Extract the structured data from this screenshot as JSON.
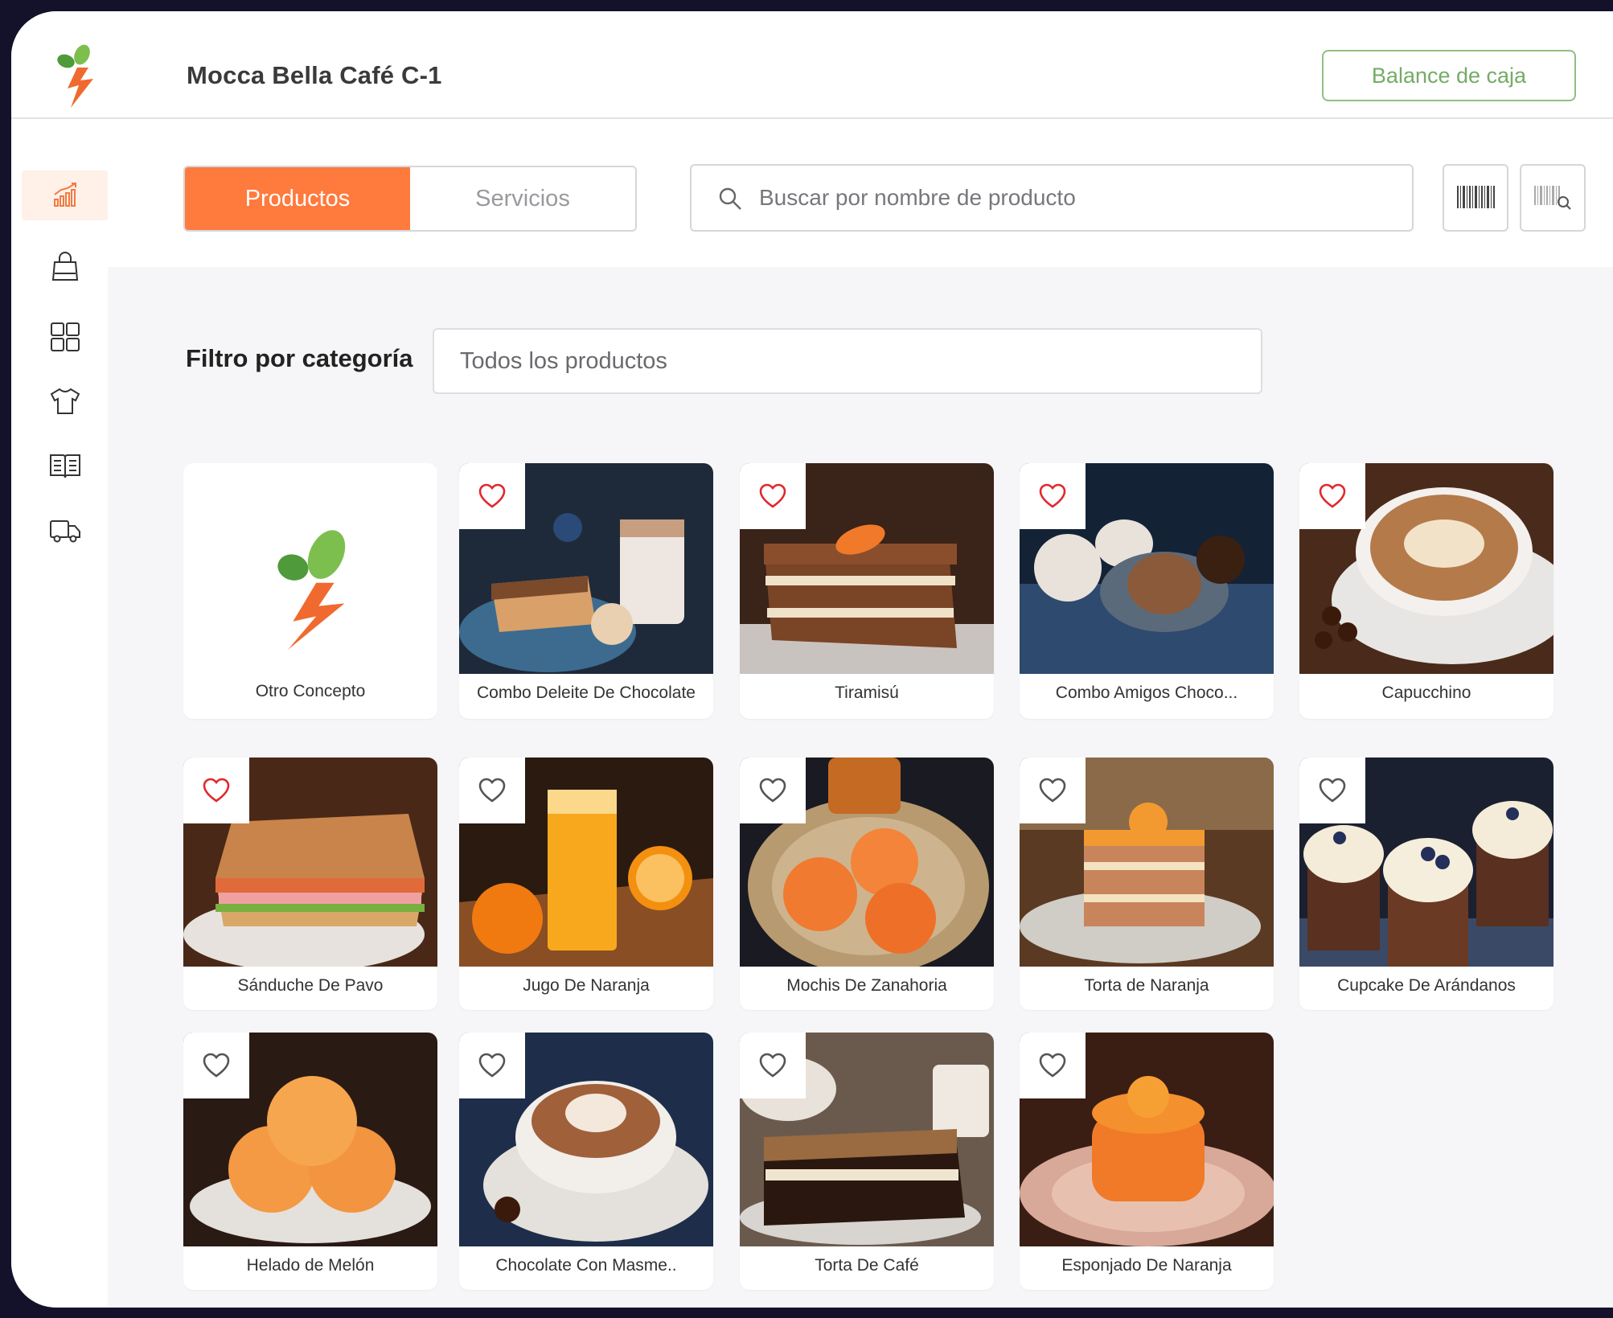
{
  "app": {
    "store_name": "Mocca Bella Café C-1",
    "balance_button": "Balance de caja",
    "accent_color": "#ff7a3d",
    "brand_green": "#76ab67"
  },
  "sidebar": {
    "items": [
      {
        "icon": "chart-icon",
        "active": true
      },
      {
        "icon": "shopping-bag-icon",
        "active": false
      },
      {
        "icon": "grid-icon",
        "active": false
      },
      {
        "icon": "shirt-icon",
        "active": false
      },
      {
        "icon": "book-icon",
        "active": false
      },
      {
        "icon": "truck-icon",
        "active": false
      }
    ]
  },
  "tabs": [
    {
      "label": "Productos",
      "active": true
    },
    {
      "label": "Servicios",
      "active": false
    }
  ],
  "search": {
    "placeholder": "Buscar por nombre de producto"
  },
  "filter": {
    "label": "Filtro por categoría",
    "value": "Todos los productos"
  },
  "products": [
    {
      "name": "Otro Concepto",
      "favorite": null
    },
    {
      "name": "Combo Deleite De Chocolate",
      "favorite": true
    },
    {
      "name": "Tiramisú",
      "favorite": true
    },
    {
      "name": "Combo Amigos Choco...",
      "favorite": true
    },
    {
      "name": "Capucchino",
      "favorite": true
    },
    {
      "name": "Sánduche De Pavo",
      "favorite": true
    },
    {
      "name": "Jugo De Naranja",
      "favorite": false
    },
    {
      "name": "Mochis De Zanahoria",
      "favorite": false
    },
    {
      "name": "Torta de Naranja",
      "favorite": false
    },
    {
      "name": "Cupcake De Arándanos",
      "favorite": false
    },
    {
      "name": "Helado de Melón",
      "favorite": false
    },
    {
      "name": "Chocolate Con Masme..",
      "favorite": false
    },
    {
      "name": "Torta De Café",
      "favorite": false
    },
    {
      "name": "Esponjado De Naranja",
      "favorite": false
    }
  ]
}
